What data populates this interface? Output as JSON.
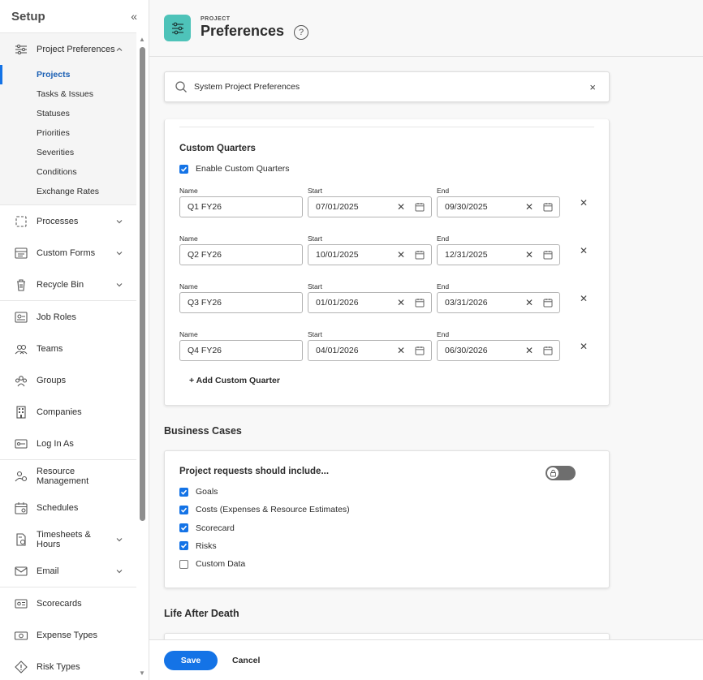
{
  "sidebar": {
    "title": "Setup",
    "collapse_icon": "double-chevron-left-icon",
    "expanded_section": {
      "label": "Project Preferences",
      "icon": "sliders-icon"
    },
    "sub_items": [
      "Projects",
      "Tasks & Issues",
      "Statuses",
      "Priorities",
      "Severities",
      "Conditions",
      "Exchange Rates"
    ],
    "active_sub_item": "Projects",
    "items": [
      {
        "label": "Processes",
        "icon": "process-icon",
        "chevron": true
      },
      {
        "label": "Custom Forms",
        "icon": "form-icon",
        "chevron": true
      },
      {
        "label": "Recycle Bin",
        "icon": "trash-icon",
        "chevron": true
      },
      {
        "label": "Job Roles",
        "icon": "job-roles-icon",
        "chevron": false
      },
      {
        "label": "Teams",
        "icon": "teams-icon",
        "chevron": false
      },
      {
        "label": "Groups",
        "icon": "groups-icon",
        "chevron": false
      },
      {
        "label": "Companies",
        "icon": "building-icon",
        "chevron": false
      },
      {
        "label": "Log In As",
        "icon": "login-icon",
        "chevron": false
      },
      {
        "label": "Resource Management",
        "icon": "resource-icon",
        "chevron": false
      },
      {
        "label": "Schedules",
        "icon": "calendar-icon",
        "chevron": false
      },
      {
        "label": "Timesheets & Hours",
        "icon": "timesheet-icon",
        "chevron": true
      },
      {
        "label": "Email",
        "icon": "email-icon",
        "chevron": true
      },
      {
        "label": "Scorecards",
        "icon": "scorecard-icon",
        "chevron": false
      },
      {
        "label": "Expense Types",
        "icon": "money-icon",
        "chevron": false
      },
      {
        "label": "Risk Types",
        "icon": "risk-icon",
        "chevron": false
      }
    ]
  },
  "header": {
    "kicker": "PROJECT",
    "title": "Preferences",
    "help": "?"
  },
  "search": {
    "value": "System Project Preferences",
    "clear": "×"
  },
  "custom_quarters": {
    "title": "Custom Quarters",
    "enable_label": "Enable Custom Quarters",
    "enabled": true,
    "labels": {
      "name": "Name",
      "start": "Start",
      "end": "End"
    },
    "rows": [
      {
        "name": "Q1 FY26",
        "start": "07/01/2025",
        "end": "09/30/2025"
      },
      {
        "name": "Q2 FY26",
        "start": "10/01/2025",
        "end": "12/31/2025"
      },
      {
        "name": "Q3 FY26",
        "start": "01/01/2026",
        "end": "03/31/2026"
      },
      {
        "name": "Q4 FY26",
        "start": "04/01/2026",
        "end": "06/30/2026"
      }
    ],
    "add_label": "+ Add Custom Quarter"
  },
  "business_cases": {
    "heading": "Business Cases",
    "prompt": "Project requests should include...",
    "locked_toggle": "lock-icon",
    "options": [
      {
        "label": "Goals",
        "checked": true
      },
      {
        "label": "Costs (Expenses & Resource Estimates)",
        "checked": true
      },
      {
        "label": "Scorecard",
        "checked": true
      },
      {
        "label": "Risks",
        "checked": true
      },
      {
        "label": "Custom Data",
        "checked": false
      }
    ]
  },
  "life_after_death": {
    "heading": "Life After Death"
  },
  "footer": {
    "save": "Save",
    "cancel": "Cancel"
  },
  "colors": {
    "accent": "#1473e6",
    "page_icon": "#4ec3b9"
  }
}
